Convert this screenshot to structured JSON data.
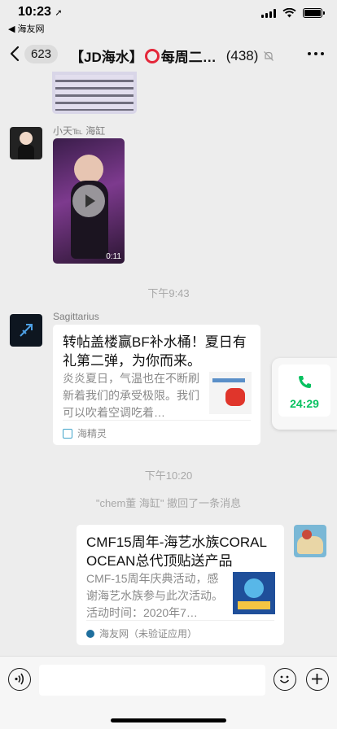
{
  "status": {
    "time": "10:23",
    "back_app": "◀ 海友网"
  },
  "nav": {
    "unread_count": "623",
    "title_prefix": "【JD海水】",
    "title_suffix": "每周二…",
    "member_count": "(438)"
  },
  "messages": {
    "m1": {
      "sender": "小天℡ 海缸",
      "video_duration": "0:11"
    },
    "sep1": "下午9:43",
    "m2": {
      "sender": "Sagittarius",
      "title": "转帖盖楼赢BF补水桶！夏日有礼第二弹，为你而来。",
      "desc": "炎炎夏日，气温也在不断刷新着我们的承受极限。我们可以吹着空调吃着…",
      "source": "海精灵"
    },
    "sep2": "下午10:20",
    "recall": "\"chem董 海缸\" 撤回了一条消息",
    "m3": {
      "title": "CMF15周年-海艺水族CORAL OCEAN总代顶贴送产品",
      "desc": "CMF-15周年庆典活动，感谢海艺水族参与此次活动。活动时间：2020年7…",
      "source": "海友网（未验证应用）"
    }
  },
  "call": {
    "duration": "24:29"
  },
  "colors": {
    "accent_green": "#07c160",
    "background": "#ededed",
    "bubble": "#ffffff"
  }
}
